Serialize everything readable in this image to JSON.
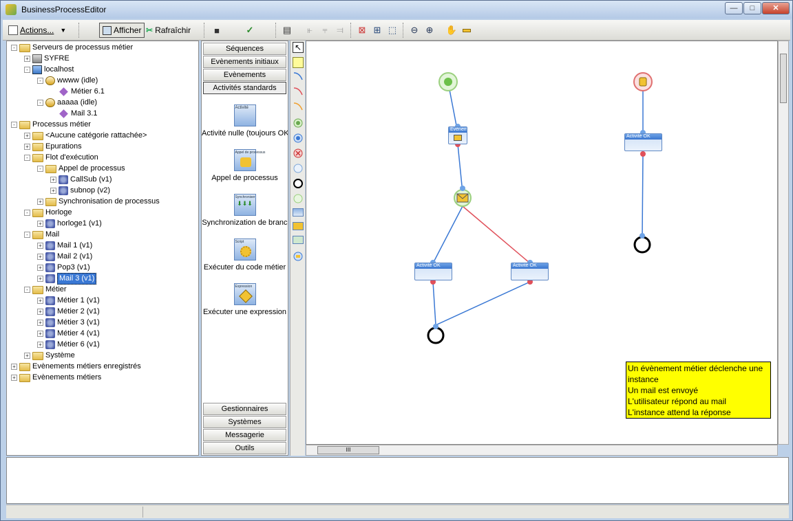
{
  "window": {
    "title": "BusinessProcessEditor",
    "min_glyph": "—",
    "max_glyph": "□",
    "close_glyph": "✕"
  },
  "toolbar": {
    "actions_label": "Actions...",
    "dropdown_glyph": "▼",
    "afficher_label": "Afficher",
    "rafraichir_label": "Rafraîchir",
    "icons": [
      "save-icon",
      "validate-icon",
      "print-icon",
      "align-left-icon",
      "align-center-icon",
      "align-right-icon",
      "grid-snap-icon",
      "grid-icon",
      "grid-dotted-icon",
      "zoom-out-icon",
      "zoom-in-icon",
      "pan-hand-icon",
      "minus-icon"
    ]
  },
  "tree": {
    "items": [
      {
        "label": "Serveurs de processus métier",
        "icon": "folder"
      },
      {
        "label": "SYFRE",
        "icon": "server"
      },
      {
        "label": "localhost",
        "icon": "host"
      },
      {
        "label": "wwww (idle)",
        "icon": "process"
      },
      {
        "label": "Métier 6.1",
        "icon": "diamond"
      },
      {
        "label": "aaaaa (idle)",
        "icon": "process"
      },
      {
        "label": "Mail 3.1",
        "icon": "diamond"
      },
      {
        "label": "Processus métier",
        "icon": "folder"
      },
      {
        "label": "<Aucune catégorie rattachée>",
        "icon": "folder"
      },
      {
        "label": "Epurations",
        "icon": "folder"
      },
      {
        "label": "Flot d'exécution",
        "icon": "folder"
      },
      {
        "label": "Appel de processus",
        "icon": "folder"
      },
      {
        "label": "CallSub (v1)",
        "icon": "gear"
      },
      {
        "label": "subnop (v2)",
        "icon": "gear"
      },
      {
        "label": "Synchronisation de processus",
        "icon": "folder"
      },
      {
        "label": "Horloge",
        "icon": "folder"
      },
      {
        "label": "horloge1 (v1)",
        "icon": "gear"
      },
      {
        "label": "Mail",
        "icon": "folder"
      },
      {
        "label": "Mail 1 (v1)",
        "icon": "gear"
      },
      {
        "label": "Mail 2 (v1)",
        "icon": "gear"
      },
      {
        "label": "Pop3 (v1)",
        "icon": "gear"
      },
      {
        "label": "Mail 3 (v1)",
        "icon": "gear"
      },
      {
        "label": "Métier",
        "icon": "folder"
      },
      {
        "label": "Métier 1 (v1)",
        "icon": "gear"
      },
      {
        "label": "Métier 2 (v1)",
        "icon": "gear"
      },
      {
        "label": "Métier 3 (v1)",
        "icon": "gear"
      },
      {
        "label": "Métier 4 (v1)",
        "icon": "gear"
      },
      {
        "label": "Métier 6 (v1)",
        "icon": "gear"
      },
      {
        "label": "Système",
        "icon": "folder"
      },
      {
        "label": "Evènements métiers enregistrés",
        "icon": "folder"
      },
      {
        "label": "Evènements métiers",
        "icon": "folder"
      }
    ],
    "selected": "Mail 3 (v1)"
  },
  "palette": {
    "top_tabs": [
      "Séquences",
      "Evènements initiaux",
      "Evènements",
      "Activités standards"
    ],
    "bottom_tabs": [
      "Gestionnaires",
      "Systèmes",
      "Messagerie",
      "Outils"
    ],
    "items": [
      {
        "label": "Activité nulle (toujours OK",
        "thumb": "Activité"
      },
      {
        "label": "Appel de processus",
        "thumb": "Appel de processus"
      },
      {
        "label": "Synchronization de branc",
        "thumb": "Synchroniser"
      },
      {
        "label": "Exécuter du code métier",
        "thumb": "Script"
      },
      {
        "label": "Exécuter une expression",
        "thumb": "Expression"
      }
    ]
  },
  "canvas": {
    "nodes": [
      {
        "label": "Evènement mail"
      },
      {
        "label": "Activité OK"
      },
      {
        "label": "Activité OK"
      },
      {
        "label": "Activité OK"
      }
    ],
    "note_lines": [
      "Un évènement métier déclenche une",
      "instance",
      "Un mail est envoyé",
      "L'utilisateur répond au mail",
      "L'instance attend la réponse"
    ],
    "colors": {
      "note": "#ffff00",
      "link_blue": "#3a78d4",
      "link_red": "#e0505a",
      "start_green": "#8bd16a"
    }
  },
  "hscroll_label": "III"
}
